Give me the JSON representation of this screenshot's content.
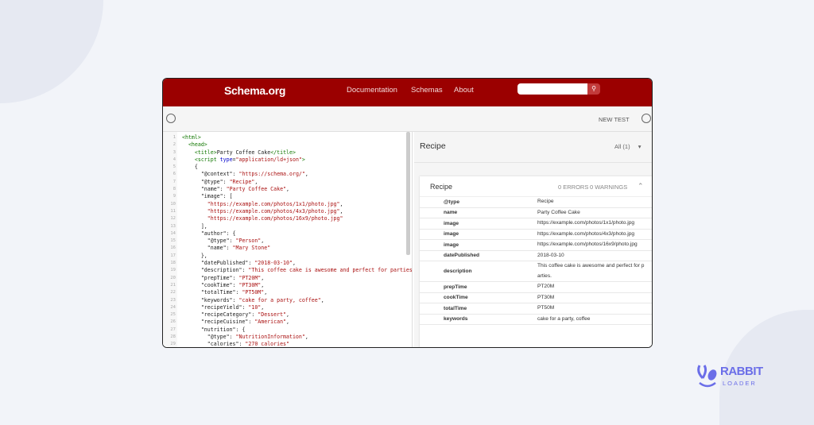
{
  "header": {
    "logo": "Schema.org",
    "nav": [
      "Documentation",
      "Schemas",
      "About"
    ],
    "search_placeholder": "",
    "search_icon": "search-icon"
  },
  "toolbar": {
    "new_test": "NEW TEST"
  },
  "code_lines": [
    [
      [
        "tag",
        "<html>"
      ]
    ],
    [
      [
        "pl",
        "  "
      ],
      [
        "tag",
        "<head>"
      ]
    ],
    [
      [
        "pl",
        "    "
      ],
      [
        "tag",
        "<title>"
      ],
      [
        "key",
        "Party Coffee Cake"
      ],
      [
        "tag",
        "</title>"
      ]
    ],
    [
      [
        "pl",
        "    "
      ],
      [
        "tag",
        "<script "
      ],
      [
        "attr",
        "type"
      ],
      [
        "pl",
        "="
      ],
      [
        "str",
        "\"application/ld+json\""
      ],
      [
        "tag",
        ">"
      ]
    ],
    [
      [
        "pl",
        "    {"
      ]
    ],
    [
      [
        "key",
        "      \"@context\""
      ],
      [
        "pl",
        ": "
      ],
      [
        "str",
        "\"https://schema.org/\""
      ],
      [
        "pl",
        ","
      ]
    ],
    [
      [
        "key",
        "      \"@type\""
      ],
      [
        "pl",
        ": "
      ],
      [
        "str",
        "\"Recipe\""
      ],
      [
        "pl",
        ","
      ]
    ],
    [
      [
        "key",
        "      \"name\""
      ],
      [
        "pl",
        ": "
      ],
      [
        "str",
        "\"Party Coffee Cake\""
      ],
      [
        "pl",
        ","
      ]
    ],
    [
      [
        "key",
        "      \"image\""
      ],
      [
        "pl",
        ": ["
      ]
    ],
    [
      [
        "str",
        "        \"https://example.com/photos/1x1/photo.jpg\""
      ],
      [
        "pl",
        ","
      ]
    ],
    [
      [
        "str",
        "        \"https://example.com/photos/4x3/photo.jpg\""
      ],
      [
        "pl",
        ","
      ]
    ],
    [
      [
        "str",
        "        \"https://example.com/photos/16x9/photo.jpg\""
      ]
    ],
    [
      [
        "pl",
        "      ],"
      ]
    ],
    [
      [
        "key",
        "      \"author\""
      ],
      [
        "pl",
        ": {"
      ]
    ],
    [
      [
        "key",
        "        \"@type\""
      ],
      [
        "pl",
        ": "
      ],
      [
        "str",
        "\"Person\""
      ],
      [
        "pl",
        ","
      ]
    ],
    [
      [
        "key",
        "        \"name\""
      ],
      [
        "pl",
        ": "
      ],
      [
        "str",
        "\"Mary Stone\""
      ]
    ],
    [
      [
        "pl",
        "      },"
      ]
    ],
    [
      [
        "key",
        "      \"datePublished\""
      ],
      [
        "pl",
        ": "
      ],
      [
        "str",
        "\"2018-03-10\""
      ],
      [
        "pl",
        ","
      ]
    ],
    [
      [
        "key",
        "      \"description\""
      ],
      [
        "pl",
        ": "
      ],
      [
        "str",
        "\"This coffee cake is awesome and perfect for parties.\""
      ],
      [
        "pl",
        ","
      ]
    ],
    [
      [
        "key",
        "      \"prepTime\""
      ],
      [
        "pl",
        ": "
      ],
      [
        "str",
        "\"PT20M\""
      ],
      [
        "pl",
        ","
      ]
    ],
    [
      [
        "key",
        "      \"cookTime\""
      ],
      [
        "pl",
        ": "
      ],
      [
        "str",
        "\"PT30M\""
      ],
      [
        "pl",
        ","
      ]
    ],
    [
      [
        "key",
        "      \"totalTime\""
      ],
      [
        "pl",
        ": "
      ],
      [
        "str",
        "\"PT50M\""
      ],
      [
        "pl",
        ","
      ]
    ],
    [
      [
        "key",
        "      \"keywords\""
      ],
      [
        "pl",
        ": "
      ],
      [
        "str",
        "\"cake for a party, coffee\""
      ],
      [
        "pl",
        ","
      ]
    ],
    [
      [
        "key",
        "      \"recipeYield\""
      ],
      [
        "pl",
        ": "
      ],
      [
        "str",
        "\"10\""
      ],
      [
        "pl",
        ","
      ]
    ],
    [
      [
        "key",
        "      \"recipeCategory\""
      ],
      [
        "pl",
        ": "
      ],
      [
        "str",
        "\"Dessert\""
      ],
      [
        "pl",
        ","
      ]
    ],
    [
      [
        "key",
        "      \"recipeCuisine\""
      ],
      [
        "pl",
        ": "
      ],
      [
        "str",
        "\"American\""
      ],
      [
        "pl",
        ","
      ]
    ],
    [
      [
        "key",
        "      \"nutrition\""
      ],
      [
        "pl",
        ": {"
      ]
    ],
    [
      [
        "key",
        "        \"@type\""
      ],
      [
        "pl",
        ": "
      ],
      [
        "str",
        "\"NutritionInformation\""
      ],
      [
        "pl",
        ","
      ]
    ],
    [
      [
        "key",
        "        \"calories\""
      ],
      [
        "pl",
        ": "
      ],
      [
        "str",
        "\"270 calories\""
      ]
    ]
  ],
  "results": {
    "title": "Recipe",
    "filter": "All (1)",
    "card_title": "Recipe",
    "errors": "0 ERRORS",
    "warnings": "0 WARNINGS",
    "rows": [
      {
        "k": "@type",
        "v": "Recipe"
      },
      {
        "k": "name",
        "v": "Party Coffee Cake"
      },
      {
        "k": "image",
        "v": "https://example.com/photos/1x1/photo.jpg"
      },
      {
        "k": "image",
        "v": "https://example.com/photos/4x3/photo.jpg"
      },
      {
        "k": "image",
        "v": "https://example.com/photos/16x9/photo.jpg"
      },
      {
        "k": "datePublished",
        "v": "2018-03-10"
      },
      {
        "k": "description",
        "v": "This coffee cake is awesome and perfect for parties."
      },
      {
        "k": "prepTime",
        "v": "PT20M"
      },
      {
        "k": "cookTime",
        "v": "PT30M"
      },
      {
        "k": "totalTime",
        "v": "PT50M"
      },
      {
        "k": "keywords",
        "v": "cake for a party, coffee"
      }
    ]
  },
  "brand": {
    "name": "RABBIT",
    "sub": "LOADER"
  },
  "colors": {
    "header": "#9b0000",
    "brand": "#6b6ee8"
  }
}
